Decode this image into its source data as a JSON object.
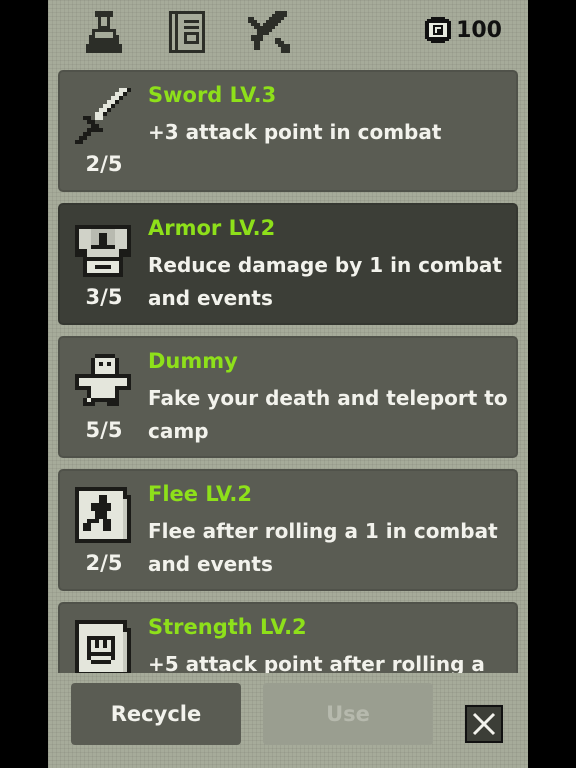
{
  "header": {
    "tabs": [
      {
        "icon": "potion-icon"
      },
      {
        "icon": "scroll-icon"
      },
      {
        "icon": "crossed-sword-icon"
      }
    ],
    "coin_icon": "coin-icon",
    "coins": "100"
  },
  "items": [
    {
      "icon": "sword-icon",
      "title": "Sword LV.3",
      "count": "2/5",
      "description": "+3 attack point in combat"
    },
    {
      "icon": "armor-icon",
      "title": "Armor LV.2",
      "count": "3/5",
      "description": "Reduce damage by 1 in combat and events",
      "selected": true
    },
    {
      "icon": "ghost-dummy-icon",
      "title": "Dummy",
      "count": "5/5",
      "description": "Fake your death and teleport to camp"
    },
    {
      "icon": "flee-scroll-icon",
      "title": "Flee LV.2",
      "count": "2/5",
      "description": "Flee after rolling a 1 in combat and events"
    },
    {
      "icon": "strength-scroll-icon",
      "title": "Strength LV.2",
      "count": "",
      "description": "+5 attack point after rolling a"
    }
  ],
  "footer": {
    "recycle_label": "Recycle",
    "use_label": "Use",
    "close_icon": "close-icon"
  },
  "colors": {
    "screen_bg": "#a6ab9a",
    "card_bg": "#5a5c53",
    "card_selected_bg": "#3c3e37",
    "title_green": "#8ee01a",
    "text_light": "#f2f2ec"
  }
}
